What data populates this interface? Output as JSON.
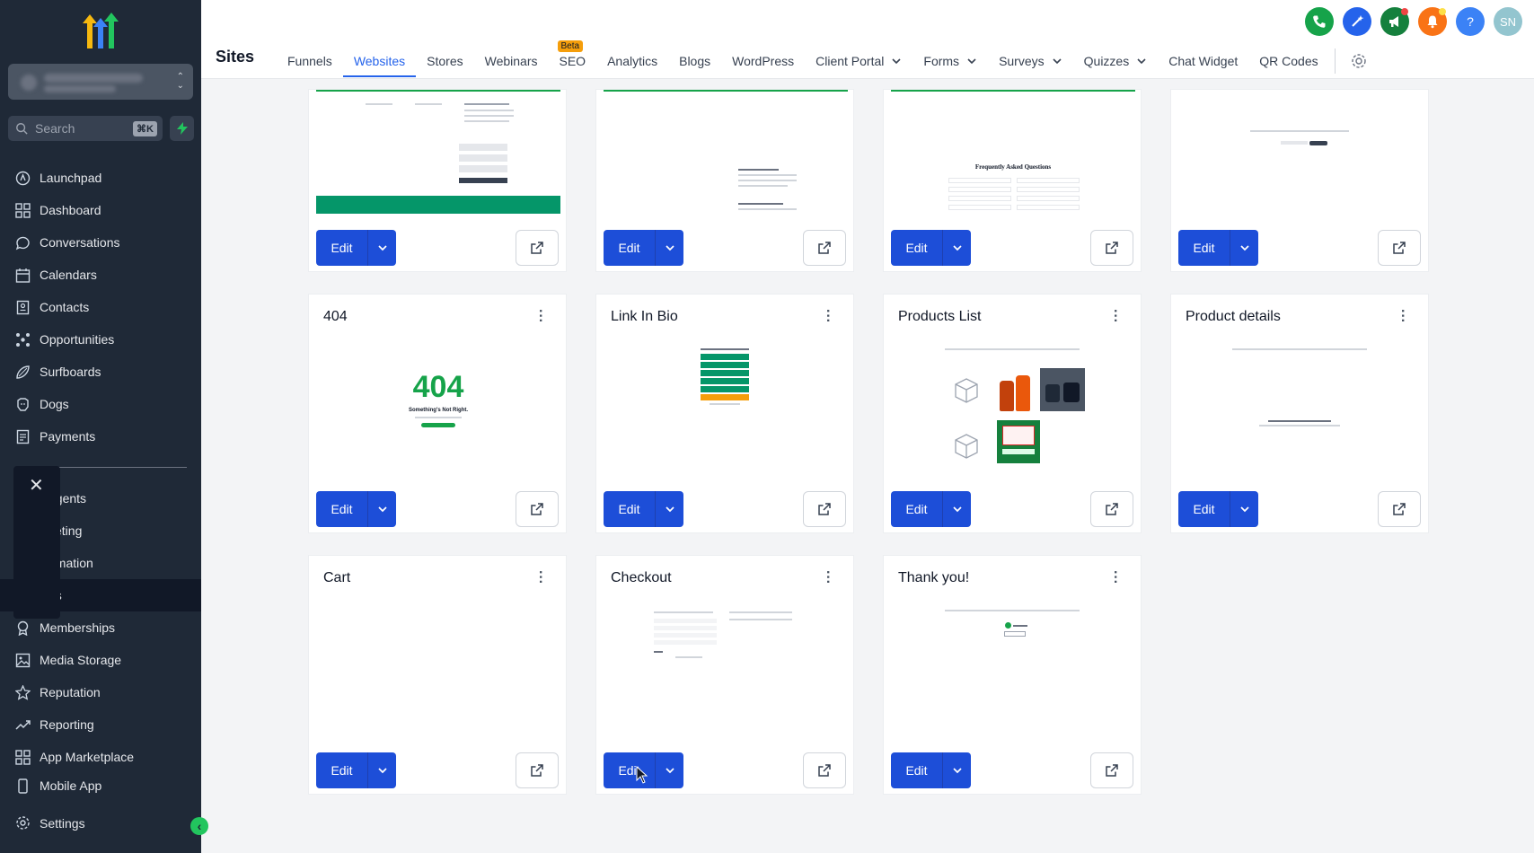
{
  "sidebar": {
    "search_placeholder": "Search",
    "search_shortcut": "⌘K",
    "items": [
      {
        "label": "Launchpad",
        "icon": "launchpad-icon"
      },
      {
        "label": "Dashboard",
        "icon": "dashboard-icon"
      },
      {
        "label": "Conversations",
        "icon": "chat-icon"
      },
      {
        "label": "Calendars",
        "icon": "calendar-icon"
      },
      {
        "label": "Contacts",
        "icon": "contacts-icon"
      },
      {
        "label": "Opportunities",
        "icon": "opportunities-icon"
      },
      {
        "label": "Surfboards",
        "icon": "surfboard-icon"
      },
      {
        "label": "Dogs",
        "icon": "dog-icon"
      },
      {
        "label": "Payments",
        "icon": "payments-icon"
      }
    ],
    "items2": [
      {
        "label": "agents"
      },
      {
        "label": "keting"
      },
      {
        "label": "omation"
      },
      {
        "label": "es"
      },
      {
        "label": "Memberships",
        "icon": "memberships-icon"
      },
      {
        "label": "Media Storage",
        "icon": "media-icon"
      },
      {
        "label": "Reputation",
        "icon": "star-icon"
      },
      {
        "label": "Reporting",
        "icon": "reporting-icon"
      },
      {
        "label": "App Marketplace",
        "icon": "marketplace-icon"
      },
      {
        "label": "Mobile App",
        "icon": "mobile-icon"
      }
    ],
    "settings": "Settings"
  },
  "header": {
    "title": "Sites",
    "tabs": [
      "Funnels",
      "Websites",
      "Stores",
      "Webinars",
      "SEO",
      "Analytics",
      "Blogs",
      "WordPress",
      "Client Portal",
      "Forms",
      "Surveys",
      "Quizzes",
      "Chat Widget",
      "QR Codes"
    ],
    "seo_badge": "Beta",
    "active_tab": "Websites",
    "avatar": "SN",
    "help": "?"
  },
  "cards": {
    "edit_label": "Edit",
    "row2": [
      "404",
      "Link In Bio",
      "Products List",
      "Product details"
    ],
    "row3": [
      "Cart",
      "Checkout",
      "Thank you!"
    ],
    "thumb_404_big": "404",
    "thumb_404_sub": "Something's Not Right.",
    "thumb_faq": "Frequently Asked Questions"
  },
  "colors": {
    "primary": "#1d4ed8",
    "sidebar": "#1f2937",
    "accent_green": "#16a34a"
  }
}
